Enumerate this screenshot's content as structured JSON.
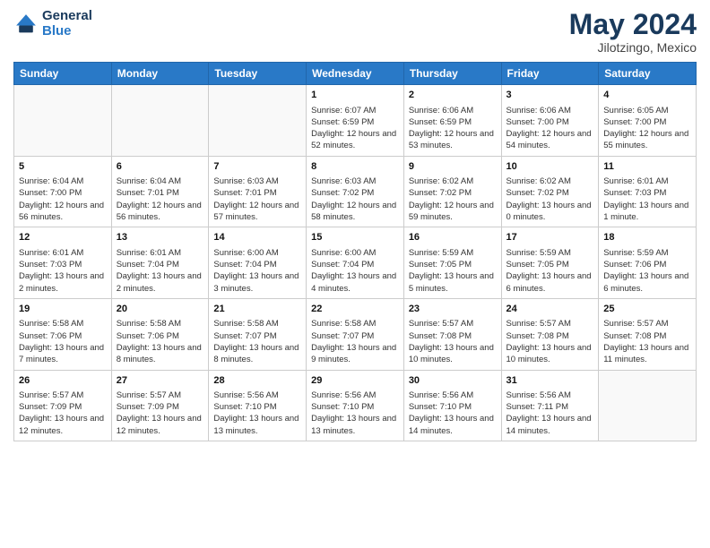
{
  "header": {
    "logo_line1": "General",
    "logo_line2": "Blue",
    "month_year": "May 2024",
    "location": "Jilotzingo, Mexico"
  },
  "weekdays": [
    "Sunday",
    "Monday",
    "Tuesday",
    "Wednesday",
    "Thursday",
    "Friday",
    "Saturday"
  ],
  "weeks": [
    [
      {
        "day": "",
        "info": ""
      },
      {
        "day": "",
        "info": ""
      },
      {
        "day": "",
        "info": ""
      },
      {
        "day": "1",
        "info": "Sunrise: 6:07 AM\nSunset: 6:59 PM\nDaylight: 12 hours\nand 52 minutes."
      },
      {
        "day": "2",
        "info": "Sunrise: 6:06 AM\nSunset: 6:59 PM\nDaylight: 12 hours\nand 53 minutes."
      },
      {
        "day": "3",
        "info": "Sunrise: 6:06 AM\nSunset: 7:00 PM\nDaylight: 12 hours\nand 54 minutes."
      },
      {
        "day": "4",
        "info": "Sunrise: 6:05 AM\nSunset: 7:00 PM\nDaylight: 12 hours\nand 55 minutes."
      }
    ],
    [
      {
        "day": "5",
        "info": "Sunrise: 6:04 AM\nSunset: 7:00 PM\nDaylight: 12 hours\nand 56 minutes."
      },
      {
        "day": "6",
        "info": "Sunrise: 6:04 AM\nSunset: 7:01 PM\nDaylight: 12 hours\nand 56 minutes."
      },
      {
        "day": "7",
        "info": "Sunrise: 6:03 AM\nSunset: 7:01 PM\nDaylight: 12 hours\nand 57 minutes."
      },
      {
        "day": "8",
        "info": "Sunrise: 6:03 AM\nSunset: 7:02 PM\nDaylight: 12 hours\nand 58 minutes."
      },
      {
        "day": "9",
        "info": "Sunrise: 6:02 AM\nSunset: 7:02 PM\nDaylight: 12 hours\nand 59 minutes."
      },
      {
        "day": "10",
        "info": "Sunrise: 6:02 AM\nSunset: 7:02 PM\nDaylight: 13 hours\nand 0 minutes."
      },
      {
        "day": "11",
        "info": "Sunrise: 6:01 AM\nSunset: 7:03 PM\nDaylight: 13 hours\nand 1 minute."
      }
    ],
    [
      {
        "day": "12",
        "info": "Sunrise: 6:01 AM\nSunset: 7:03 PM\nDaylight: 13 hours\nand 2 minutes."
      },
      {
        "day": "13",
        "info": "Sunrise: 6:01 AM\nSunset: 7:04 PM\nDaylight: 13 hours\nand 2 minutes."
      },
      {
        "day": "14",
        "info": "Sunrise: 6:00 AM\nSunset: 7:04 PM\nDaylight: 13 hours\nand 3 minutes."
      },
      {
        "day": "15",
        "info": "Sunrise: 6:00 AM\nSunset: 7:04 PM\nDaylight: 13 hours\nand 4 minutes."
      },
      {
        "day": "16",
        "info": "Sunrise: 5:59 AM\nSunset: 7:05 PM\nDaylight: 13 hours\nand 5 minutes."
      },
      {
        "day": "17",
        "info": "Sunrise: 5:59 AM\nSunset: 7:05 PM\nDaylight: 13 hours\nand 6 minutes."
      },
      {
        "day": "18",
        "info": "Sunrise: 5:59 AM\nSunset: 7:06 PM\nDaylight: 13 hours\nand 6 minutes."
      }
    ],
    [
      {
        "day": "19",
        "info": "Sunrise: 5:58 AM\nSunset: 7:06 PM\nDaylight: 13 hours\nand 7 minutes."
      },
      {
        "day": "20",
        "info": "Sunrise: 5:58 AM\nSunset: 7:06 PM\nDaylight: 13 hours\nand 8 minutes."
      },
      {
        "day": "21",
        "info": "Sunrise: 5:58 AM\nSunset: 7:07 PM\nDaylight: 13 hours\nand 8 minutes."
      },
      {
        "day": "22",
        "info": "Sunrise: 5:58 AM\nSunset: 7:07 PM\nDaylight: 13 hours\nand 9 minutes."
      },
      {
        "day": "23",
        "info": "Sunrise: 5:57 AM\nSunset: 7:08 PM\nDaylight: 13 hours\nand 10 minutes."
      },
      {
        "day": "24",
        "info": "Sunrise: 5:57 AM\nSunset: 7:08 PM\nDaylight: 13 hours\nand 10 minutes."
      },
      {
        "day": "25",
        "info": "Sunrise: 5:57 AM\nSunset: 7:08 PM\nDaylight: 13 hours\nand 11 minutes."
      }
    ],
    [
      {
        "day": "26",
        "info": "Sunrise: 5:57 AM\nSunset: 7:09 PM\nDaylight: 13 hours\nand 12 minutes."
      },
      {
        "day": "27",
        "info": "Sunrise: 5:57 AM\nSunset: 7:09 PM\nDaylight: 13 hours\nand 12 minutes."
      },
      {
        "day": "28",
        "info": "Sunrise: 5:56 AM\nSunset: 7:10 PM\nDaylight: 13 hours\nand 13 minutes."
      },
      {
        "day": "29",
        "info": "Sunrise: 5:56 AM\nSunset: 7:10 PM\nDaylight: 13 hours\nand 13 minutes."
      },
      {
        "day": "30",
        "info": "Sunrise: 5:56 AM\nSunset: 7:10 PM\nDaylight: 13 hours\nand 14 minutes."
      },
      {
        "day": "31",
        "info": "Sunrise: 5:56 AM\nSunset: 7:11 PM\nDaylight: 13 hours\nand 14 minutes."
      },
      {
        "day": "",
        "info": ""
      }
    ]
  ]
}
